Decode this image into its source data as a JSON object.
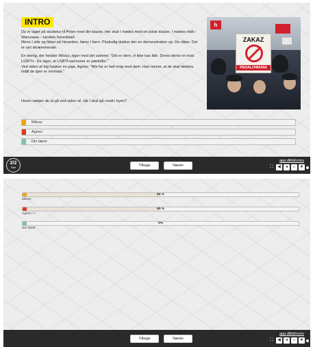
{
  "slide1": {
    "intro": "INTRO",
    "paragraphs": [
      "Du er taget på studietur til Polen med din klasse. Her skal I mødes med en polsk klasse. I mødes midt i Warszawa – landets hovedstad.",
      "Mens I står og hilser på hinanden, hører I larm. Pludselig dukker der en demonstration op. De råber. Det er rart skræmmende.",
      "En dreng, der hedder Milosz, siger med det samme: \"Det er dem, vi ikke kan lide. Deres demo er mod LGBTI+. De siger, at LGBTI+personer er pædofile.\"",
      "Ved siden af dig hvisker en pige, Agnes: \"Min far er helt enig med dem. Han mener, at de skal tæskes, indtil de igen er normale.\""
    ],
    "question": "Hvem vælger du at gå ved siden af, når I skal gå rundt i byen?",
    "photo": {
      "logo_text": "h",
      "sign_top": "ZAKAZ",
      "sign_bottom": "PEDALOWANIA"
    },
    "options": [
      {
        "label": "Milosz",
        "color": "#f4a30c"
      },
      {
        "label": "Agnes",
        "color": "#de3a1e"
      },
      {
        "label": "Din lærer",
        "color": "#7fc3a7"
      }
    ]
  },
  "nav": {
    "counter": "2/2",
    "counter_sub": "Slide",
    "back": "Tilbage",
    "next": "Næste",
    "link": "app.dilbit/rcmv",
    "tools": [
      "expand-icon",
      "rewind-icon",
      "back-icon",
      "home-icon",
      "star-icon"
    ]
  },
  "slide2": {
    "results": [
      {
        "label": "Milosz",
        "percent_text": "50 %",
        "percent": 50,
        "color": "#f4a30c"
      },
      {
        "label": "Agnes ++",
        "percent_text": "50 %",
        "percent": 50,
        "color": "#de3a1e"
      },
      {
        "label": "Din lærer",
        "percent_text": "0%",
        "percent": 0,
        "color": "#7fc3a7"
      }
    ]
  }
}
